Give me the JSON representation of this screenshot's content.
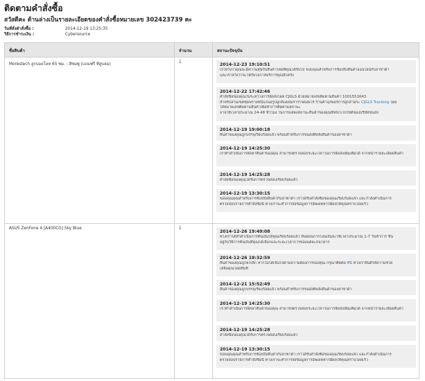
{
  "page": {
    "title": "ติดตามคำสั่งซื้อ",
    "subtitle": "สวัสดีคะ ด้านล่างเป็นรายละเอียดของคำสั่งซื้อหมายเลข 302423739 คะ"
  },
  "order_meta": {
    "date_label": "วันที่สั่งคำสั่งซื้อ :",
    "date_value": "2014-12-19 13:25:35",
    "payment_label": "วิธีการชำระเงิน :",
    "payment_value": "Cybersource"
  },
  "table": {
    "headers": [
      "ชื่อสินค้า",
      "จำนวน",
      "สถานะปัจจุบัน"
    ],
    "items": [
      {
        "name": "Morestech ลูกบอลโลห 65 ซม. - สีชมพู (แถมฟรี ที่สูบลม)",
        "qty": "1",
        "events": [
          {
            "datetime": "2014-12-23 19:10:51",
            "lines": [
              "เราหวังว่าคุณจะมีความสุขกับสินค้าใหม่ที่คุณได้รับไป ขอบคุณสำหรับการช้อปปิ้งสินค้าออนไลน์กับลาซาด้า",
              "และเราหวังว่าจะได้รับโอกาสบริการคุณอีกครั้ง"
            ]
          },
          {
            "datetime": "2014-12-22 17:42:46",
            "lines": [
              "คำสั่งซื้อของคุณในระหว่างการจัดส่งโดย CJGLS ด้วยหมายเลขติดตามสินค้า 1001551643",
              "สำหรับสามเขตชุมพรายชนินในอรูปลูกดิแยลมรารโรดมพวร์ ร้านค้าฉุรพธร์การลูกสามระ CJGLS Tracking โดย",
              "ใส่หมายเลขติดตามสินค้าเพื่อทำการติดตามสถานะ",
              "อาจใช้เวลาประมาณ 24-48 ชั่วโมง ในการแสดงสถานะสินค้าของคุณที่หน้าเวปไซต์ของบริษัทขนส่ง"
            ],
            "link": "CJGLS Tracking"
          },
          {
            "datetime": "2014-12-19 19:00:18",
            "lines": [
              "สินค้าของคุณถูกบรรจุเรียบร้อยแล้ว พร้อมสำหรับการขนส่งที่คลังสินค้าของลาซาด้า"
            ]
          },
          {
            "datetime": "2014-12-19 14:25:30",
            "lines": [
              "เราทำดำเนินการจัดหาสินค้าของคุณ สามารถตรวจสอบระยะเวลาในการจัดส่งเพิ่มเติมได้ จากหน้ารายละเอียดสินค้า"
            ]
          },
          {
            "datetime": "2014-12-19 14:25:28",
            "lines": [
              "คำสั่งซื้อของคุณได้รับการตรวจสอบเรียบร้อยแล้ว"
            ]
          },
          {
            "datetime": "2014-12-19 13:30:15",
            "lines": [
              "ขอบคุณคุณสำหรับการช้อปปิ้งสินค้ากับลาซาด้า เราได้รับคำสั่งซื้อของคุณเรียบร้อยแล้ว และกำลังดำเนินการ",
              "ตรวจสอบรายการคำสั่งซื้อนี้ ทางเราจะทำการส่งข้อมูลการอัพเดทหากมีผลให้คุณทราบโดยเร็ว"
            ]
          }
        ]
      },
      {
        "name": "ASUS ZenFone 4 [A400CG] Sky Blue",
        "qty": "1",
        "events": [
          {
            "datetime": "2014-12-26 19:49:08",
            "lines": [
              "ทางเราได้ทำดำเนินการคืนเงินให้คุณเรียบร้อยแล้ว ขั้นตอนการโอนเงินจะใช้เวลาประมาณ 1-7 วันทำการ ขึ้น",
              "อยู่กับวิธีการคืนเงินที่คุณได้เลือกและระยะเวลาการของแต่ละธนาคาร"
            ]
          },
          {
            "datetime": "2014-12-26 18:32:59",
            "lines": [
              "สินค้าของคุณถูกยกเลิก หากไม่ได้เป็นไปตามความต้องการของคุณ กรุณาติดต่อ ที่นี่ ทางเรายินดีให้ความช่วย",
              "เหลือคุณโดยทันที"
            ],
            "link": "ที่นี่"
          },
          {
            "datetime": "2014-12-21 15:52:49",
            "lines": [
              "สินค้าของคุณถูกบรรจุเรียบร้อยแล้ว พร้อมสำหรับการขนส่งที่คลังสินค้าของลาซาด้า"
            ]
          },
          {
            "datetime": "2014-12-19 14:25:30",
            "lines": [
              "เราทำดำเนินการจัดหาสินค้าของคุณ สามารถตรวจสอบระยะเวลาในการจัดส่งเพิ่มเติมได้ จากหน้ารายละเอียดสินค้า"
            ]
          },
          {
            "datetime": "2014-12-19 14:25:28",
            "lines": [
              "คำสั่งซื้อของคุณได้รับการตรวจสอบเรียบร้อยแล้ว"
            ]
          },
          {
            "datetime": "2014-12-19 13:30:15",
            "lines": [
              "ขอบคุณคุณสำหรับการช้อปปิ้งสินค้ากับลาซาด้า เราได้รับคำสั่งซื้อของคุณเรียบร้อยแล้ว และกำลังดำเนินการ",
              "ตรวจสอบรายการคำสั่งซื้อนี้ ทางเราจะทำการส่งข้อมูลการอัพเดทหากมีผลให้คุณทราบโดยเร็ว"
            ]
          }
        ]
      }
    ]
  },
  "colors": {
    "event_bg": "#efefef",
    "header_bg": "#e6e6e6",
    "link": "#2a7ab8",
    "border": "#cfcfcf"
  }
}
